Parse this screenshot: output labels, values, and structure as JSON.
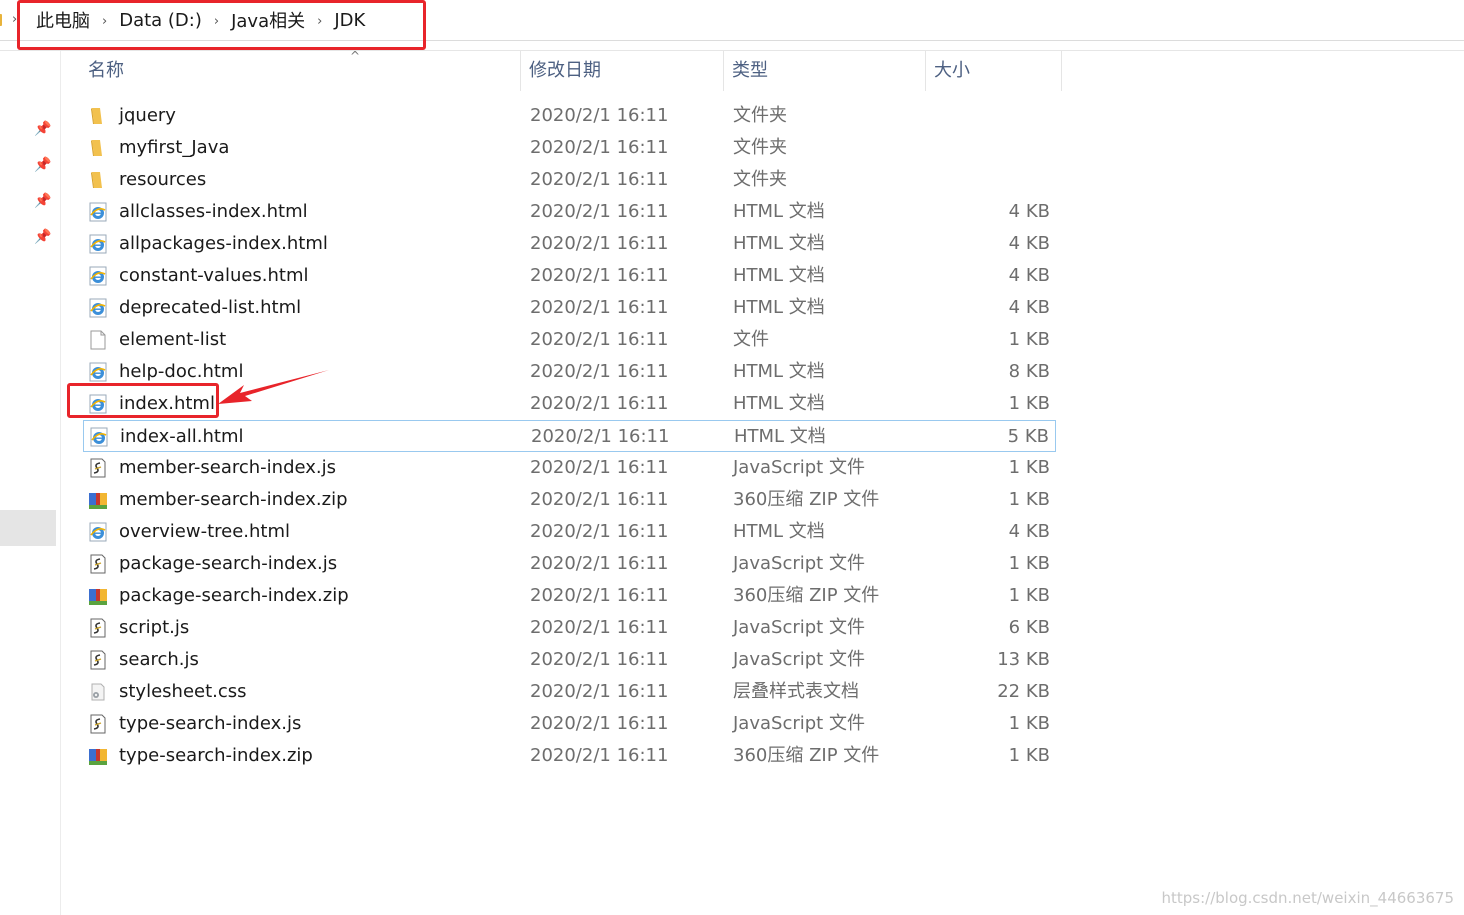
{
  "breadcrumb": [
    "此电脑",
    "Data (D:)",
    "Java相关",
    "JDK"
  ],
  "columns": {
    "name": "名称",
    "date": "修改日期",
    "type": "类型",
    "size": "大小"
  },
  "files": [
    {
      "name": "jquery",
      "date": "2020/2/1 16:11",
      "type": "文件夹",
      "size": "",
      "icon": "folder-icon"
    },
    {
      "name": "myfirst_Java",
      "date": "2020/2/1 16:11",
      "type": "文件夹",
      "size": "",
      "icon": "folder-icon"
    },
    {
      "name": "resources",
      "date": "2020/2/1 16:11",
      "type": "文件夹",
      "size": "",
      "icon": "folder-icon"
    },
    {
      "name": "allclasses-index.html",
      "date": "2020/2/1 16:11",
      "type": "HTML 文档",
      "size": "4 KB",
      "icon": "html-file-icon"
    },
    {
      "name": "allpackages-index.html",
      "date": "2020/2/1 16:11",
      "type": "HTML 文档",
      "size": "4 KB",
      "icon": "html-file-icon"
    },
    {
      "name": "constant-values.html",
      "date": "2020/2/1 16:11",
      "type": "HTML 文档",
      "size": "4 KB",
      "icon": "html-file-icon"
    },
    {
      "name": "deprecated-list.html",
      "date": "2020/2/1 16:11",
      "type": "HTML 文档",
      "size": "4 KB",
      "icon": "html-file-icon"
    },
    {
      "name": "element-list",
      "date": "2020/2/1 16:11",
      "type": "文件",
      "size": "1 KB",
      "icon": "blank-file-icon"
    },
    {
      "name": "help-doc.html",
      "date": "2020/2/1 16:11",
      "type": "HTML 文档",
      "size": "8 KB",
      "icon": "html-file-icon"
    },
    {
      "name": "index.html",
      "date": "2020/2/1 16:11",
      "type": "HTML 文档",
      "size": "1 KB",
      "icon": "html-file-icon"
    },
    {
      "name": "index-all.html",
      "date": "2020/2/1 16:11",
      "type": "HTML 文档",
      "size": "5 KB",
      "icon": "html-file-icon",
      "selected": true
    },
    {
      "name": "member-search-index.js",
      "date": "2020/2/1 16:11",
      "type": "JavaScript 文件",
      "size": "1 KB",
      "icon": "script-file-icon"
    },
    {
      "name": "member-search-index.zip",
      "date": "2020/2/1 16:11",
      "type": "360压缩 ZIP 文件",
      "size": "1 KB",
      "icon": "zip-file-icon"
    },
    {
      "name": "overview-tree.html",
      "date": "2020/2/1 16:11",
      "type": "HTML 文档",
      "size": "4 KB",
      "icon": "html-file-icon"
    },
    {
      "name": "package-search-index.js",
      "date": "2020/2/1 16:11",
      "type": "JavaScript 文件",
      "size": "1 KB",
      "icon": "script-file-icon"
    },
    {
      "name": "package-search-index.zip",
      "date": "2020/2/1 16:11",
      "type": "360压缩 ZIP 文件",
      "size": "1 KB",
      "icon": "zip-file-icon"
    },
    {
      "name": "script.js",
      "date": "2020/2/1 16:11",
      "type": "JavaScript 文件",
      "size": "6 KB",
      "icon": "script-file-icon"
    },
    {
      "name": "search.js",
      "date": "2020/2/1 16:11",
      "type": "JavaScript 文件",
      "size": "13 KB",
      "icon": "script-file-icon"
    },
    {
      "name": "stylesheet.css",
      "date": "2020/2/1 16:11",
      "type": "层叠样式表文档",
      "size": "22 KB",
      "icon": "css-file-icon"
    },
    {
      "name": "type-search-index.js",
      "date": "2020/2/1 16:11",
      "type": "JavaScript 文件",
      "size": "1 KB",
      "icon": "script-file-icon"
    },
    {
      "name": "type-search-index.zip",
      "date": "2020/2/1 16:11",
      "type": "360压缩 ZIP 文件",
      "size": "1 KB",
      "icon": "zip-file-icon"
    }
  ],
  "watermark": "https://blog.csdn.net/weixin_44663675",
  "colors": {
    "annotation": "#e8242a",
    "selection_border": "#99c9ef",
    "header_text": "#4d6082"
  }
}
